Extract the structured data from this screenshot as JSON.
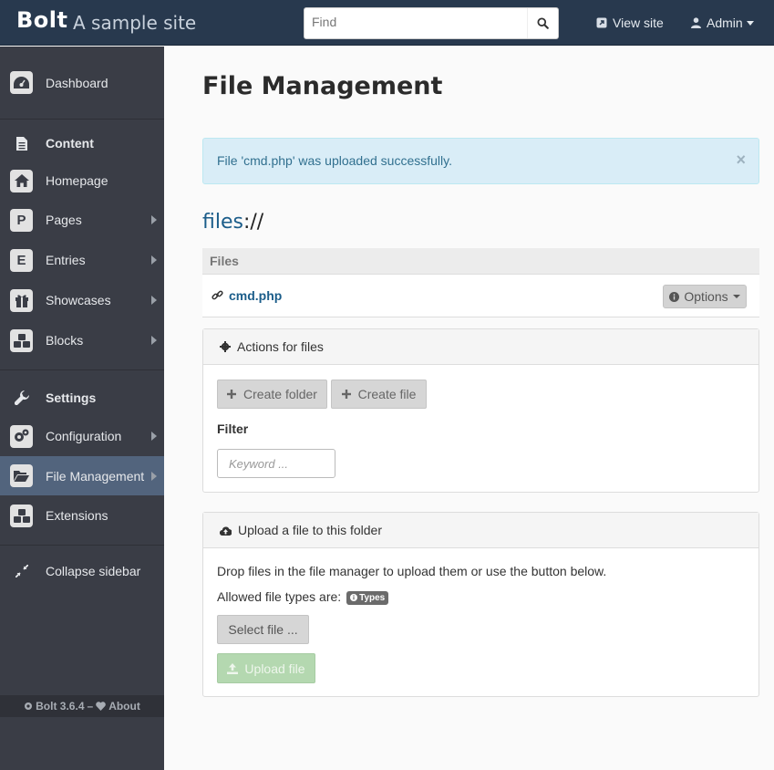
{
  "topbar": {
    "brand": "Bolt",
    "site_title": "A sample site",
    "search_placeholder": "Find",
    "view_site": "View site",
    "user": "Admin"
  },
  "sidebar": {
    "dashboard": "Dashboard",
    "content_header": "Content",
    "homepage": "Homepage",
    "pages": "Pages",
    "pages_letter": "P",
    "entries": "Entries",
    "entries_letter": "E",
    "showcases": "Showcases",
    "blocks": "Blocks",
    "settings_header": "Settings",
    "configuration": "Configuration",
    "file_management": "File Management",
    "extensions": "Extensions",
    "collapse": "Collapse sidebar",
    "footer_version": "Bolt 3.6.4",
    "footer_dash": "–",
    "footer_about": "About"
  },
  "main": {
    "title": "File Management",
    "alert": "File 'cmd.php' was uploaded successfully.",
    "alert_close": "×",
    "path_root": "files",
    "path_sep": "://",
    "files_header": "Files",
    "files": [
      {
        "name": "cmd.php",
        "options": "Options"
      }
    ],
    "actions_panel": {
      "title": "Actions for files",
      "create_folder": "Create folder",
      "create_file": "Create file",
      "filter_label": "Filter",
      "filter_placeholder": "Keyword ..."
    },
    "upload_panel": {
      "title": "Upload a file to this folder",
      "instructions": "Drop files in the file manager to upload them or use the button below.",
      "allowed_label": "Allowed file types are:",
      "types_badge": "Types",
      "select_file": "Select file ...",
      "upload": "Upload file"
    }
  }
}
